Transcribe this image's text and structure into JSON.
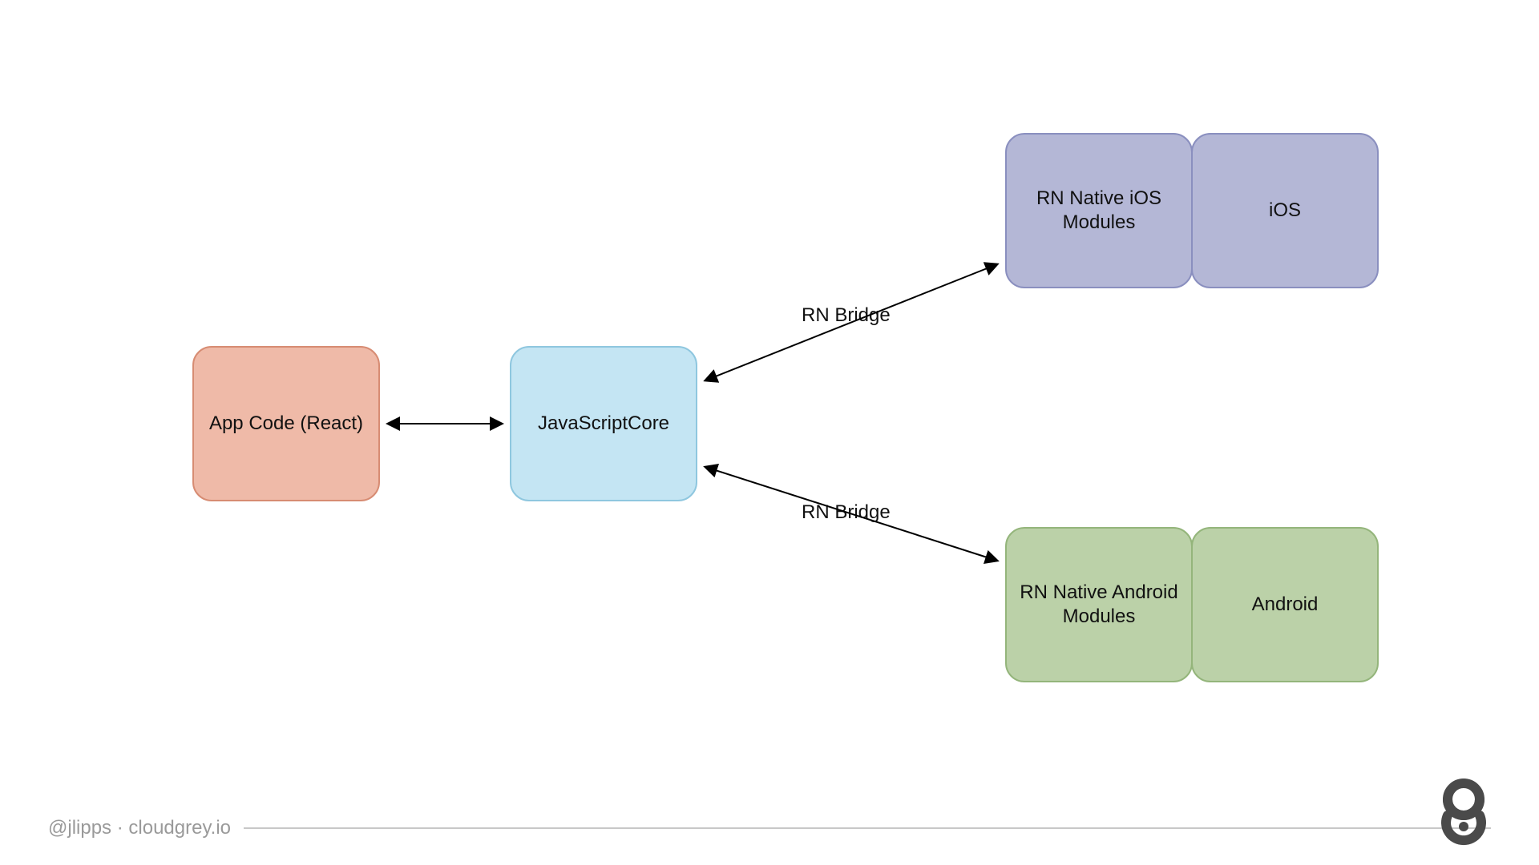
{
  "boxes": {
    "app_code": {
      "label": "App Code (React)"
    },
    "jscore": {
      "label": "JavaScriptCore"
    },
    "rn_ios": {
      "label": "RN Native iOS\nModules"
    },
    "ios": {
      "label": "iOS"
    },
    "rn_android": {
      "label": "RN Native Android\nModules"
    },
    "android": {
      "label": "Android"
    }
  },
  "edges": {
    "bridge_top": "RN Bridge",
    "bridge_bottom": "RN Bridge"
  },
  "colors": {
    "app_fill": "#EFBAA8",
    "app_stroke": "#D78C73",
    "js_fill": "#C4E5F3",
    "js_stroke": "#8FC7DF",
    "ios_fill": "#B4B7D6",
    "ios_stroke": "#8A8FBF",
    "and_fill": "#BBD1A8",
    "and_stroke": "#94B57B"
  },
  "footer": "@jlipps · cloudgrey.io"
}
